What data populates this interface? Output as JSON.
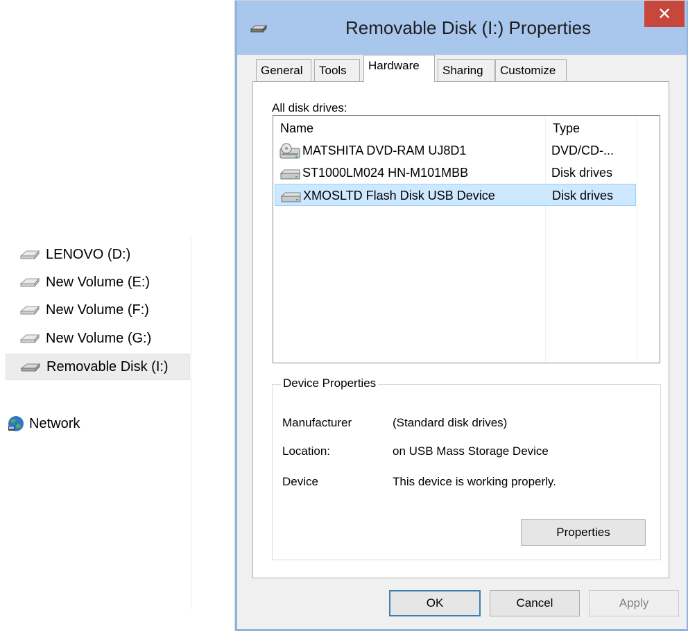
{
  "nav_pane": {
    "items": [
      {
        "label": "LENOVO (D:)",
        "icon": "drive-icon"
      },
      {
        "label": "New Volume (E:)",
        "icon": "drive-icon"
      },
      {
        "label": "New Volume (F:)",
        "icon": "drive-icon"
      },
      {
        "label": "New Volume (G:)",
        "icon": "drive-icon"
      },
      {
        "label": "Removable Disk (I:)",
        "icon": "removable-drive-icon",
        "selected": true
      }
    ],
    "network": {
      "label": "Network",
      "icon": "network-globe-icon"
    }
  },
  "dialog": {
    "title": "Removable Disk (I:) Properties",
    "close_label": "✕",
    "tabs": [
      {
        "label": "General"
      },
      {
        "label": "Tools"
      },
      {
        "label": "Hardware",
        "active": true
      },
      {
        "label": "Sharing"
      },
      {
        "label": "Customize"
      }
    ],
    "hardware": {
      "all_drives_label": "All disk drives:",
      "columns": {
        "name": "Name",
        "type": "Type"
      },
      "rows": [
        {
          "name": "MATSHITA DVD-RAM UJ8D1",
          "type": "DVD/CD-...",
          "icon": "optical-drive-icon"
        },
        {
          "name": "ST1000LM024 HN-M101MBB",
          "type": "Disk drives",
          "icon": "hard-drive-icon"
        },
        {
          "name": "XMOSLTD Flash Disk USB Device",
          "type": "Disk drives",
          "icon": "hard-drive-icon",
          "selected": true
        }
      ],
      "device_properties": {
        "title": "Device Properties",
        "manufacturer_label": "Manufacturer",
        "manufacturer_value": "(Standard disk drives)",
        "location_label": "Location:",
        "location_value": "on USB Mass Storage Device",
        "device_label": "Device",
        "device_value": "This device is working properly.",
        "properties_button": "Properties"
      }
    },
    "buttons": {
      "ok": "OK",
      "cancel": "Cancel",
      "apply": "Apply"
    }
  },
  "colors": {
    "title_bar": "#a9c7ed",
    "close_button": "#c7473c",
    "selection": "#cde8ff",
    "selection_border": "#99d1ff",
    "default_button_border": "#3c7fb1"
  }
}
